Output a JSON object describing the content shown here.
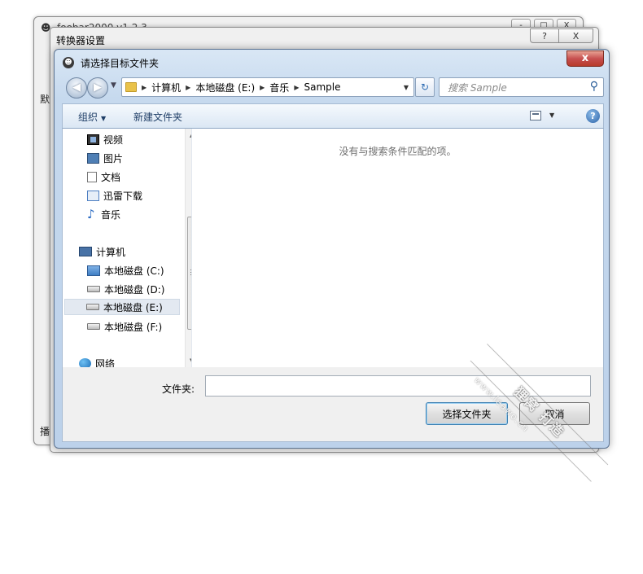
{
  "background_window": {
    "title": "foobar2000 v1.2.3",
    "side_labels": [
      "默",
      "播"
    ],
    "controls": [
      "-",
      "□",
      "X"
    ]
  },
  "settings_window": {
    "title": "转换器设置",
    "help_label": "?",
    "close_label": "X"
  },
  "dialog": {
    "title": "请选择目标文件夹",
    "close_label": "x",
    "nav": {
      "back_glyph": "◀",
      "forward_glyph": "▶"
    },
    "address": {
      "crumbs": [
        "计算机",
        "本地磁盘 (E:)",
        "音乐",
        "Sample"
      ]
    },
    "search": {
      "placeholder": "搜索 Sample"
    },
    "toolbar": {
      "organize_label": "组织",
      "new_folder_label": "新建文件夹"
    },
    "nav_pane": {
      "libraries": [
        "视频",
        "图片",
        "文档",
        "迅雷下载",
        "音乐"
      ],
      "computer_label": "计算机",
      "drives": [
        "本地磁盘 (C:)",
        "本地磁盘 (D:)",
        "本地磁盘 (E:)",
        "本地磁盘 (F:)"
      ],
      "selected_drive": "本地磁盘 (E:)",
      "network_label": "网络"
    },
    "content": {
      "empty_message": "没有与搜索条件匹配的项。"
    },
    "folder_label": "文件夹:",
    "folder_value": "",
    "select_button": "选择文件夹",
    "cancel_button": "取消"
  },
  "watermark": {
    "main_text": "狸窝 打造",
    "sub_text": "www.leawo.cn"
  }
}
